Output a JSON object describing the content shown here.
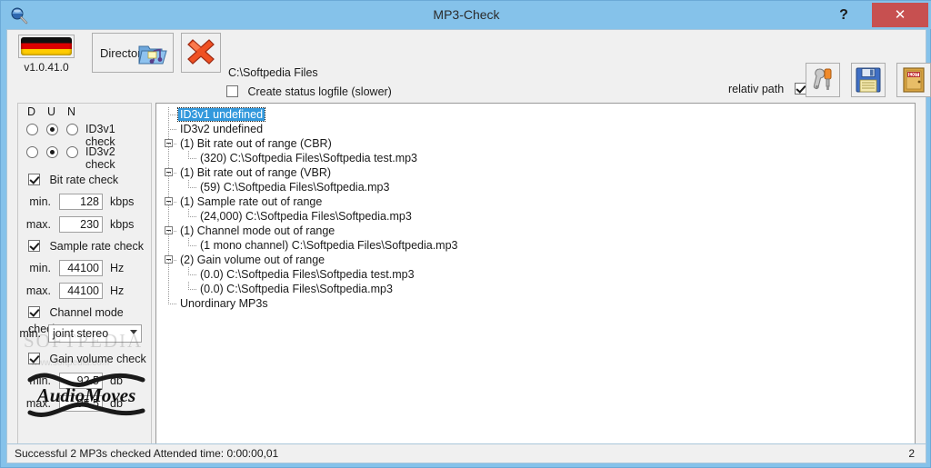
{
  "window": {
    "title": "MP3-Check",
    "app_icon": "magnifier-icon",
    "help_label": "?",
    "close_label": "✕"
  },
  "toolbar": {
    "flag_icon": "german-flag-icon",
    "version": "v1.0.41.0",
    "directory_label": "Directory",
    "directory_icon": "music-folder-icon",
    "clear_icon": "red-x-icon",
    "path": "C:\\Softpedia Files",
    "logfile_label": "Create status logfile (slower)",
    "logfile_checked": false,
    "relative_path_label": "relativ path",
    "relative_path_checked": true,
    "settings_icon": "wrench-screwdriver-icon",
    "save_icon": "floppy-disk-icon",
    "exit_icon": "exit-door-icon"
  },
  "options": {
    "column_headers": [
      "D",
      "U",
      "N"
    ],
    "radio_rows": [
      {
        "label": "ID3v1 check",
        "selected": "U"
      },
      {
        "label": "ID3v2 check",
        "selected": "U"
      }
    ],
    "bitrate": {
      "label": "Bit rate check",
      "checked": true,
      "min_label": "min.",
      "min_value": "128",
      "min_unit": "kbps",
      "max_label": "max.",
      "max_value": "230",
      "max_unit": "kbps"
    },
    "samplerate": {
      "label": "Sample rate check",
      "checked": true,
      "min_label": "min.",
      "min_value": "44100",
      "min_unit": "Hz",
      "max_label": "max.",
      "max_value": "44100",
      "max_unit": "Hz"
    },
    "channelmode": {
      "label": "Channel mode check",
      "checked": true,
      "min_label": "min.",
      "value": "joint stereo"
    },
    "gainvolume": {
      "label": "Gain volume check",
      "checked": true,
      "min_label": "min.",
      "min_value": "92.5",
      "min_unit": "db",
      "max_label": "max.",
      "max_value": "95.5",
      "max_unit": "db"
    },
    "logo_text": "AudioMoves"
  },
  "tree": {
    "nodes": [
      {
        "text": "ID3v1 undefined",
        "level": 0,
        "expander": false,
        "selected": true
      },
      {
        "text": "ID3v2 undefined",
        "level": 0,
        "expander": false,
        "selected": false
      },
      {
        "text": "(1) Bit rate out of range (CBR)",
        "level": 0,
        "expander": true,
        "selected": false
      },
      {
        "text": "(320) C:\\Softpedia Files\\Softpedia test.mp3",
        "level": 1,
        "expander": false,
        "selected": false
      },
      {
        "text": "(1) Bit rate out of range (VBR)",
        "level": 0,
        "expander": true,
        "selected": false
      },
      {
        "text": "(59) C:\\Softpedia Files\\Softpedia.mp3",
        "level": 1,
        "expander": false,
        "selected": false
      },
      {
        "text": "(1) Sample rate out of range",
        "level": 0,
        "expander": true,
        "selected": false
      },
      {
        "text": "(24,000) C:\\Softpedia Files\\Softpedia.mp3",
        "level": 1,
        "expander": false,
        "selected": false
      },
      {
        "text": "(1) Channel mode out of range",
        "level": 0,
        "expander": true,
        "selected": false
      },
      {
        "text": "(1 mono channel) C:\\Softpedia Files\\Softpedia.mp3",
        "level": 1,
        "expander": false,
        "selected": false
      },
      {
        "text": "(2) Gain volume out of range",
        "level": 0,
        "expander": true,
        "selected": false
      },
      {
        "text": "(0.0) C:\\Softpedia Files\\Softpedia test.mp3",
        "level": 1,
        "expander": false,
        "selected": false
      },
      {
        "text": "(0.0) C:\\Softpedia Files\\Softpedia.mp3",
        "level": 1,
        "expander": false,
        "selected": false
      },
      {
        "text": "Unordinary MP3s",
        "level": 0,
        "expander": false,
        "selected": false
      }
    ]
  },
  "statusbar": {
    "text": "Successful 2 MP3s checked Attended time: 0:00:00,01",
    "count": "2"
  },
  "watermark": {
    "big": "SOFTPEDIA",
    "small": "www.softpedia.com"
  },
  "colors": {
    "titlebar": "#85c2ea",
    "close": "#c75050",
    "selection": "#3399dd",
    "panel": "#f0f0f0"
  }
}
